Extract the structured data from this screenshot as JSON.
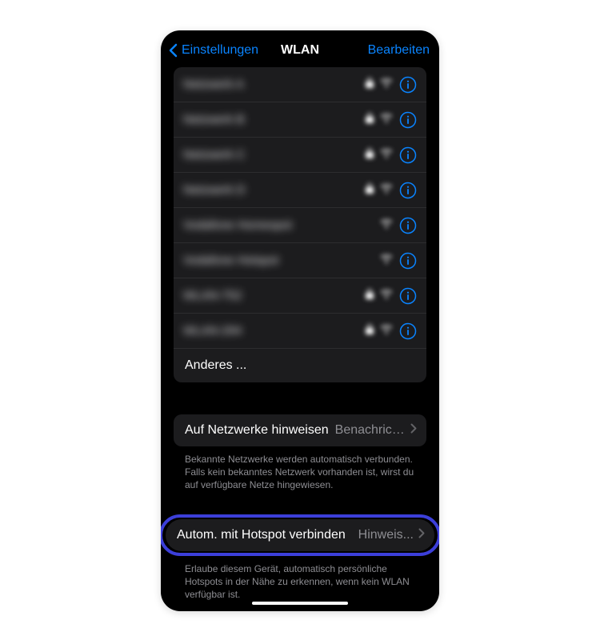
{
  "nav": {
    "back_label": "Einstellungen",
    "title": "WLAN",
    "edit_label": "Bearbeiten"
  },
  "networks": [
    {
      "name": "Netzwerk A",
      "locked": true,
      "signal": true
    },
    {
      "name": "Netzwerk B",
      "locked": true,
      "signal": true
    },
    {
      "name": "Netzwerk C",
      "locked": true,
      "signal": true
    },
    {
      "name": "Netzwerk D",
      "locked": true,
      "signal": true
    },
    {
      "name": "Vodafone Homespot",
      "locked": false,
      "signal": true
    },
    {
      "name": "Vodafone Hotspot",
      "locked": false,
      "signal": true
    },
    {
      "name": "WLAN-752",
      "locked": true,
      "signal": true
    },
    {
      "name": "WLAN-294",
      "locked": true,
      "signal": true
    }
  ],
  "other_label": "Anderes ...",
  "ask_to_join": {
    "label": "Auf Netzwerke hinweisen",
    "value": "Benachrichti...",
    "footer": "Bekannte Netzwerke werden automatisch verbunden. Falls kein bekanntes Netzwerk vorhanden ist, wirst du auf verfügbare Netze hingewiesen."
  },
  "auto_hotspot": {
    "label": "Autom. mit Hotspot verbinden",
    "value": "Hinweis...",
    "footer": "Erlaube diesem Gerät, automatisch persönliche Hotspots in der Nähe zu erkennen, wenn kein WLAN verfügbar ist."
  }
}
